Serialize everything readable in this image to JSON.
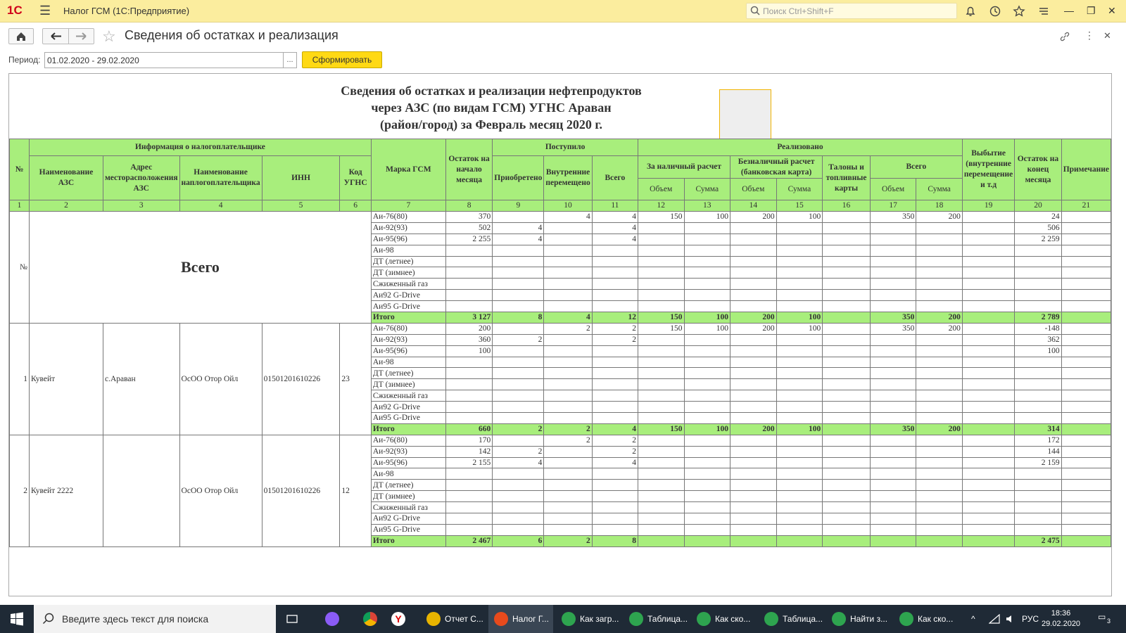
{
  "app": {
    "logo": "1С",
    "title": "Налог ГСМ  (1С:Предприятие)",
    "search_placeholder": "Поиск Ctrl+Shift+F"
  },
  "toolbar": {
    "page_title": "Сведения об остатках и реализация",
    "period_label": "Период:",
    "period_value": "01.02.2020 - 29.02.2020",
    "period_dots": "...",
    "generate_label": "Сформировать"
  },
  "report": {
    "title": [
      "Сведения об остатках и реализации нефтепродуктов",
      "через АЗС (по видам ГСМ) УГНС Араван",
      "(район/город) за Февраль месяц 2020 г."
    ],
    "headers": {
      "no": "№",
      "taxpayer": "Информация о налогоплательщике",
      "azs_name": "Наименование АЗС",
      "azs_addr": "Адрес месторасположения АЗС",
      "tp_name": "Наименование наплогоплательщика",
      "inn": "ИНН",
      "ugns": "Код УГНС",
      "grade": "Марка ГСМ",
      "open_bal": "Остаток на начало месяца",
      "received": "Поступило",
      "purchased": "Приобретено",
      "internal": "Внутренние перемещено",
      "recv_total": "Всего",
      "sold": "Реализовано",
      "cash": "За наличный расчет",
      "cashless": "Безналичный расчет (банковская карта)",
      "coupons": "Талоны и топливные карты",
      "sold_total": "Всего",
      "volume": "Объем",
      "amount": "Сумма",
      "disposal": "Выбытие (внутренние перемещение и т.д",
      "close_bal": "Остаток на конец месяца",
      "note": "Примечание"
    },
    "col_numbers": [
      "1",
      "2",
      "3",
      "4",
      "5",
      "6",
      "7",
      "8",
      "9",
      "10",
      "11",
      "12",
      "13",
      "14",
      "15",
      "16",
      "17",
      "18",
      "19",
      "20",
      "21"
    ],
    "groups": [
      {
        "no": "№",
        "label": "Всего",
        "azs": "",
        "addr": "",
        "tp": "",
        "inn": "",
        "ugns": "",
        "rows": [
          {
            "grade": "Аи-76(80)",
            "c": [
              "370",
              "",
              "4",
              "4",
              "150",
              "100",
              "200",
              "100",
              "",
              "350",
              "200",
              "",
              "24",
              ""
            ]
          },
          {
            "grade": "Аи-92(93)",
            "c": [
              "502",
              "4",
              "",
              "4",
              "",
              "",
              "",
              "",
              "",
              "",
              "",
              "",
              "506",
              ""
            ]
          },
          {
            "grade": "Аи-95(96)",
            "c": [
              "2 255",
              "4",
              "",
              "4",
              "",
              "",
              "",
              "",
              "",
              "",
              "",
              "",
              "2 259",
              ""
            ]
          },
          {
            "grade": "Аи-98",
            "c": [
              "",
              "",
              "",
              "",
              "",
              "",
              "",
              "",
              "",
              "",
              "",
              "",
              "",
              ""
            ]
          },
          {
            "grade": "ДТ (летнее)",
            "c": [
              "",
              "",
              "",
              "",
              "",
              "",
              "",
              "",
              "",
              "",
              "",
              "",
              "",
              ""
            ]
          },
          {
            "grade": "ДТ (зимнее)",
            "c": [
              "",
              "",
              "",
              "",
              "",
              "",
              "",
              "",
              "",
              "",
              "",
              "",
              "",
              ""
            ]
          },
          {
            "grade": "Сжиженный газ",
            "c": [
              "",
              "",
              "",
              "",
              "",
              "",
              "",
              "",
              "",
              "",
              "",
              "",
              "",
              ""
            ]
          },
          {
            "grade": "Аи92 G-Drive",
            "c": [
              "",
              "",
              "",
              "",
              "",
              "",
              "",
              "",
              "",
              "",
              "",
              "",
              "",
              ""
            ]
          },
          {
            "grade": "Аи95 G-Drive",
            "c": [
              "",
              "",
              "",
              "",
              "",
              "",
              "",
              "",
              "",
              "",
              "",
              "",
              "",
              ""
            ]
          }
        ],
        "total": {
          "grade": "Итого",
          "c": [
            "3 127",
            "8",
            "4",
            "12",
            "150",
            "100",
            "200",
            "100",
            "",
            "350",
            "200",
            "",
            "2 789",
            ""
          ]
        }
      },
      {
        "no": "1",
        "label": "",
        "azs": "Кувейт",
        "addr": "с.Араван",
        "tp": "ОсОО Отор Ойл",
        "inn": "01501201610226",
        "ugns": "23",
        "rows": [
          {
            "grade": "Аи-76(80)",
            "c": [
              "200",
              "",
              "2",
              "2",
              "150",
              "100",
              "200",
              "100",
              "",
              "350",
              "200",
              "",
              "-148",
              ""
            ]
          },
          {
            "grade": "Аи-92(93)",
            "c": [
              "360",
              "2",
              "",
              "2",
              "",
              "",
              "",
              "",
              "",
              "",
              "",
              "",
              "362",
              ""
            ]
          },
          {
            "grade": "Аи-95(96)",
            "c": [
              "100",
              "",
              "",
              "",
              "",
              "",
              "",
              "",
              "",
              "",
              "",
              "",
              "100",
              ""
            ]
          },
          {
            "grade": "Аи-98",
            "c": [
              "",
              "",
              "",
              "",
              "",
              "",
              "",
              "",
              "",
              "",
              "",
              "",
              "",
              ""
            ]
          },
          {
            "grade": "ДТ (летнее)",
            "c": [
              "",
              "",
              "",
              "",
              "",
              "",
              "",
              "",
              "",
              "",
              "",
              "",
              "",
              ""
            ]
          },
          {
            "grade": "ДТ (зимнее)",
            "c": [
              "",
              "",
              "",
              "",
              "",
              "",
              "",
              "",
              "",
              "",
              "",
              "",
              "",
              ""
            ]
          },
          {
            "grade": "Сжиженный газ",
            "c": [
              "",
              "",
              "",
              "",
              "",
              "",
              "",
              "",
              "",
              "",
              "",
              "",
              "",
              ""
            ]
          },
          {
            "grade": "Аи92 G-Drive",
            "c": [
              "",
              "",
              "",
              "",
              "",
              "",
              "",
              "",
              "",
              "",
              "",
              "",
              "",
              ""
            ]
          },
          {
            "grade": "Аи95 G-Drive",
            "c": [
              "",
              "",
              "",
              "",
              "",
              "",
              "",
              "",
              "",
              "",
              "",
              "",
              "",
              ""
            ]
          }
        ],
        "total": {
          "grade": "Итого",
          "c": [
            "660",
            "2",
            "2",
            "4",
            "150",
            "100",
            "200",
            "100",
            "",
            "350",
            "200",
            "",
            "314",
            ""
          ]
        }
      },
      {
        "no": "2",
        "label": "",
        "azs": "Кувейт 2222",
        "addr": "",
        "tp": "ОсОО Отор Ойл",
        "inn": "01501201610226",
        "ugns": "12",
        "rows": [
          {
            "grade": "Аи-76(80)",
            "c": [
              "170",
              "",
              "2",
              "2",
              "",
              "",
              "",
              "",
              "",
              "",
              "",
              "",
              "172",
              ""
            ]
          },
          {
            "grade": "Аи-92(93)",
            "c": [
              "142",
              "2",
              "",
              "2",
              "",
              "",
              "",
              "",
              "",
              "",
              "",
              "",
              "144",
              ""
            ]
          },
          {
            "grade": "Аи-95(96)",
            "c": [
              "2 155",
              "4",
              "",
              "4",
              "",
              "",
              "",
              "",
              "",
              "",
              "",
              "",
              "2 159",
              ""
            ]
          },
          {
            "grade": "Аи-98",
            "c": [
              "",
              "",
              "",
              "",
              "",
              "",
              "",
              "",
              "",
              "",
              "",
              "",
              "",
              ""
            ]
          },
          {
            "grade": "ДТ (летнее)",
            "c": [
              "",
              "",
              "",
              "",
              "",
              "",
              "",
              "",
              "",
              "",
              "",
              "",
              "",
              ""
            ]
          },
          {
            "grade": "ДТ (зимнее)",
            "c": [
              "",
              "",
              "",
              "",
              "",
              "",
              "",
              "",
              "",
              "",
              "",
              "",
              "",
              ""
            ]
          },
          {
            "grade": "Сжиженный газ",
            "c": [
              "",
              "",
              "",
              "",
              "",
              "",
              "",
              "",
              "",
              "",
              "",
              "",
              "",
              ""
            ]
          },
          {
            "grade": "Аи92 G-Drive",
            "c": [
              "",
              "",
              "",
              "",
              "",
              "",
              "",
              "",
              "",
              "",
              "",
              "",
              "",
              ""
            ]
          },
          {
            "grade": "Аи95 G-Drive",
            "c": [
              "",
              "",
              "",
              "",
              "",
              "",
              "",
              "",
              "",
              "",
              "",
              "",
              "",
              ""
            ]
          }
        ],
        "total": {
          "grade": "Итого",
          "c": [
            "2 467",
            "6",
            "2",
            "8",
            "",
            "",
            "",
            "",
            "",
            "",
            "",
            "",
            "2 475",
            ""
          ]
        }
      }
    ]
  },
  "taskbar": {
    "search_placeholder": "Введите здесь текст для поиска",
    "tasks": [
      {
        "label": "Отчет С...",
        "color": "#e8b400"
      },
      {
        "label": "Налог Г...",
        "color": "#e84a1c"
      },
      {
        "label": "Как загр...",
        "color": "#2ea44f"
      },
      {
        "label": "Таблица...",
        "color": "#2ea44f"
      },
      {
        "label": "Как ско...",
        "color": "#2ea44f"
      },
      {
        "label": "Таблица...",
        "color": "#2ea44f"
      },
      {
        "label": "Найти з...",
        "color": "#2ea44f"
      },
      {
        "label": "Как ско...",
        "color": "#2ea44f"
      }
    ],
    "lang": "РУС",
    "time": "18:36",
    "date": "29.02.2020",
    "notif_count": "3"
  }
}
